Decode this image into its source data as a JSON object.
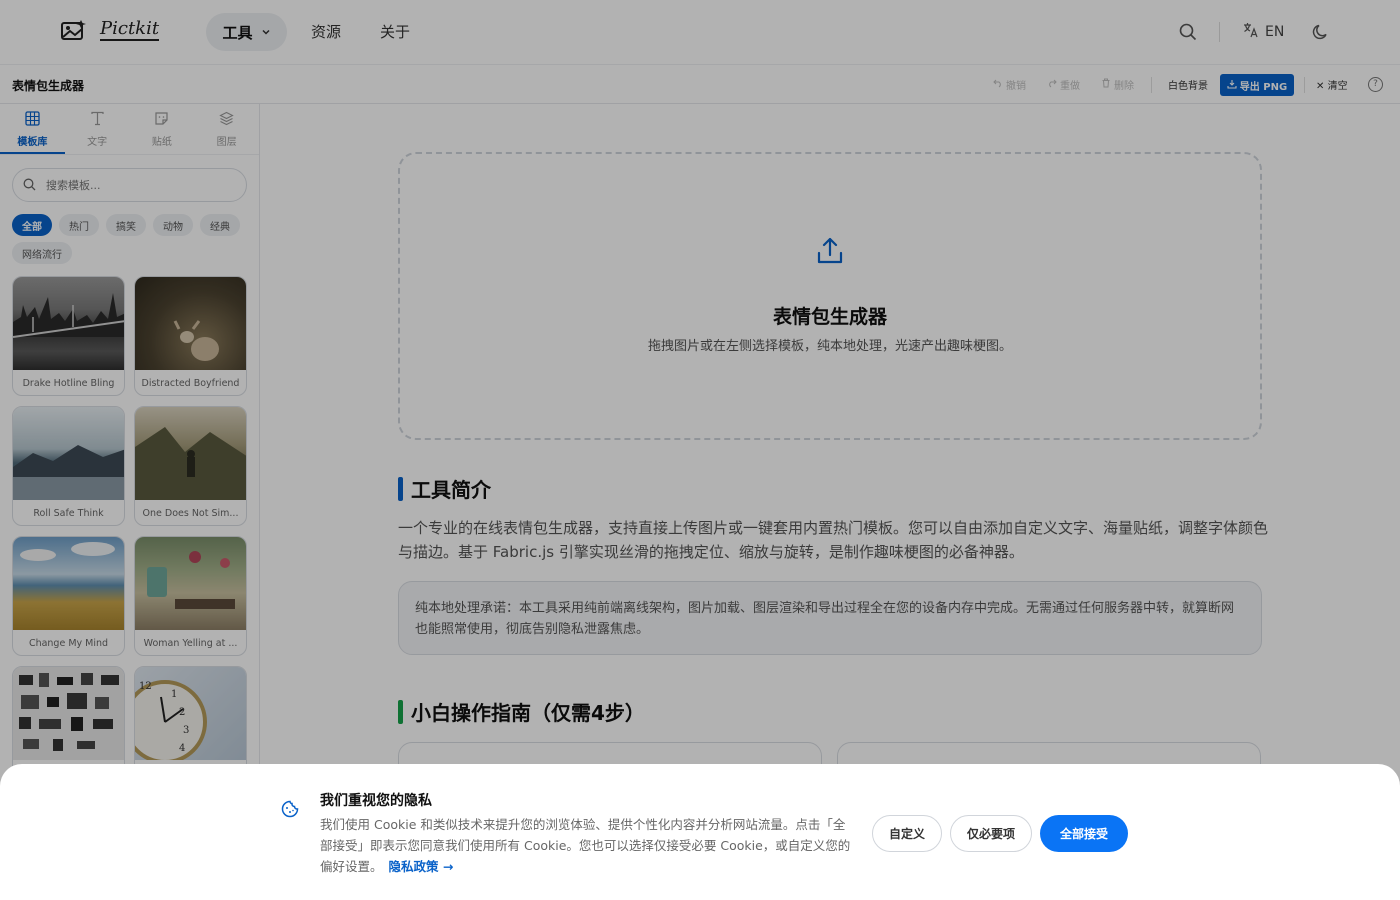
{
  "nav": {
    "logo_text": "Pictkit",
    "tools_label": "工具",
    "resources_label": "资源",
    "about_label": "关于",
    "lang_label": "EN"
  },
  "toolbar": {
    "title": "表情包生成器",
    "undo_label": "撤销",
    "redo_label": "重做",
    "delete_label": "删除",
    "white_bg_label": "白色背景",
    "export_label": "导出 PNG",
    "clear_label": "清空"
  },
  "sidebar": {
    "tabs": [
      {
        "label": "模板库",
        "icon": "grid-icon"
      },
      {
        "label": "文字",
        "icon": "text-icon"
      },
      {
        "label": "贴纸",
        "icon": "sticker-icon"
      },
      {
        "label": "图层",
        "icon": "layers-icon"
      }
    ],
    "search_placeholder": "搜索模板...",
    "chips": [
      "全部",
      "热门",
      "搞笑",
      "动物",
      "经典",
      "网络流行"
    ],
    "templates": [
      {
        "label": "Drake Hotline Bling"
      },
      {
        "label": "Distracted Boyfriend"
      },
      {
        "label": "Roll Safe Think"
      },
      {
        "label": "One Does Not Sim..."
      },
      {
        "label": "Change My Mind"
      },
      {
        "label": "Woman Yelling at ..."
      },
      {
        "label": ""
      },
      {
        "label": ""
      }
    ]
  },
  "main": {
    "dropzone_title": "表情包生成器",
    "dropzone_desc": "拖拽图片或在左侧选择模板，纯本地处理，光速产出趣味梗图。",
    "intro_heading": "工具简介",
    "intro_text": "一个专业的在线表情包生成器，支持直接上传图片或一键套用内置热门模板。您可以自由添加自定义文字、海量贴纸，调整字体颜色与描边。基于 Fabric.js 引擎实现丝滑的拖拽定位、缩放与旋转，是制作趣味梗图的必备神器。",
    "note_text": "纯本地处理承诺：本工具采用纯前端离线架构，图片加载、图层渲染和导出过程全在您的设备内存中完成。无需通过任何服务器中转，就算断网也能照常使用，彻底告别隐私泄露焦虑。",
    "guide_heading": "小白操作指南（仅需4步）"
  },
  "cookie": {
    "title": "我们重视您的隐私",
    "text": "我们使用 Cookie 和类似技术来提升您的浏览体验、提供个性化内容并分析网站流量。点击「全部接受」即表示您同意我们使用所有 Cookie。您也可以选择仅接受必要 Cookie，或自定义您的偏好设置。",
    "link_label": "隐私政策 →",
    "customize_label": "自定义",
    "necessary_label": "仅必要项",
    "accept_label": "全部接受"
  },
  "colors": {
    "accent": "#0a62c9",
    "accept_button": "#0a74f5",
    "intro_bar": "#0a62c9",
    "guide_bar": "#16a34a"
  }
}
